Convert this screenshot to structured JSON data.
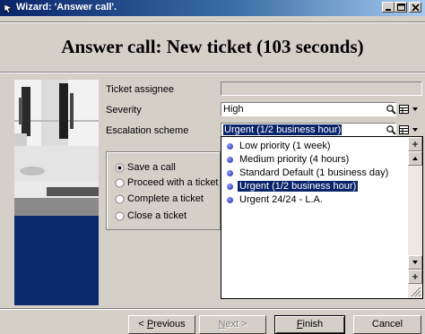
{
  "window": {
    "title": "Wizard: 'Answer call'."
  },
  "page_title": "Answer call: New ticket (103 seconds)",
  "fields": {
    "ticket_assignee": {
      "label": "Ticket assignee",
      "value": ""
    },
    "severity": {
      "label": "Severity",
      "value": "High"
    },
    "escalation_scheme": {
      "label": "Escalation scheme",
      "value": "Urgent (1/2 business hour)"
    }
  },
  "actions": {
    "options": [
      {
        "label": "Save a call",
        "checked": true
      },
      {
        "label": "Proceed with a ticket",
        "checked": false
      },
      {
        "label": "Complete a ticket",
        "checked": false
      },
      {
        "label": "Close a ticket",
        "checked": false
      }
    ]
  },
  "escalation_dropdown": {
    "items": [
      {
        "label": "Low priority (1 week)",
        "selected": false
      },
      {
        "label": "Medium priority (4 hours)",
        "selected": false
      },
      {
        "label": "Standard Default (1 business day)",
        "selected": false
      },
      {
        "label": "Urgent (1/2 business hour)",
        "selected": true
      },
      {
        "label": "Urgent 24/24 - L.A.",
        "selected": false
      }
    ]
  },
  "footer": {
    "previous": {
      "prefix": "< ",
      "accel": "P",
      "rest": "revious"
    },
    "next": {
      "accel": "N",
      "rest": "ext >"
    },
    "finish": {
      "accel": "F",
      "rest": "inish"
    },
    "cancel": "Cancel"
  }
}
